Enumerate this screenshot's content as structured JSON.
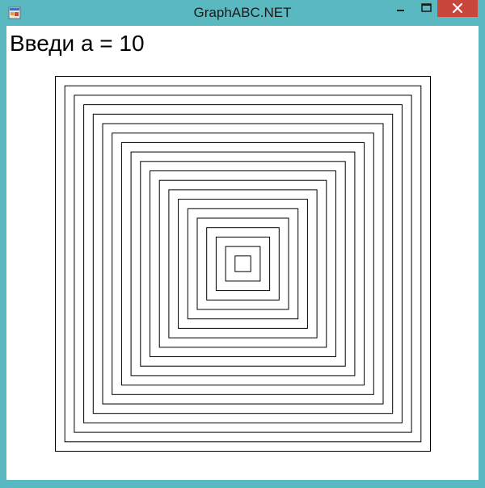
{
  "window": {
    "title": "GraphABC.NET",
    "frame_color": "#5ab8c0",
    "close_button_color": "#c9463d",
    "icons": {
      "app": "graphabc-app-icon",
      "minimize": "minimize-icon",
      "maximize": "maximize-icon",
      "close": "close-icon"
    }
  },
  "content": {
    "prompt_text": "Введи а = 10",
    "nested_squares_count": 20,
    "line_color": "#000000"
  }
}
